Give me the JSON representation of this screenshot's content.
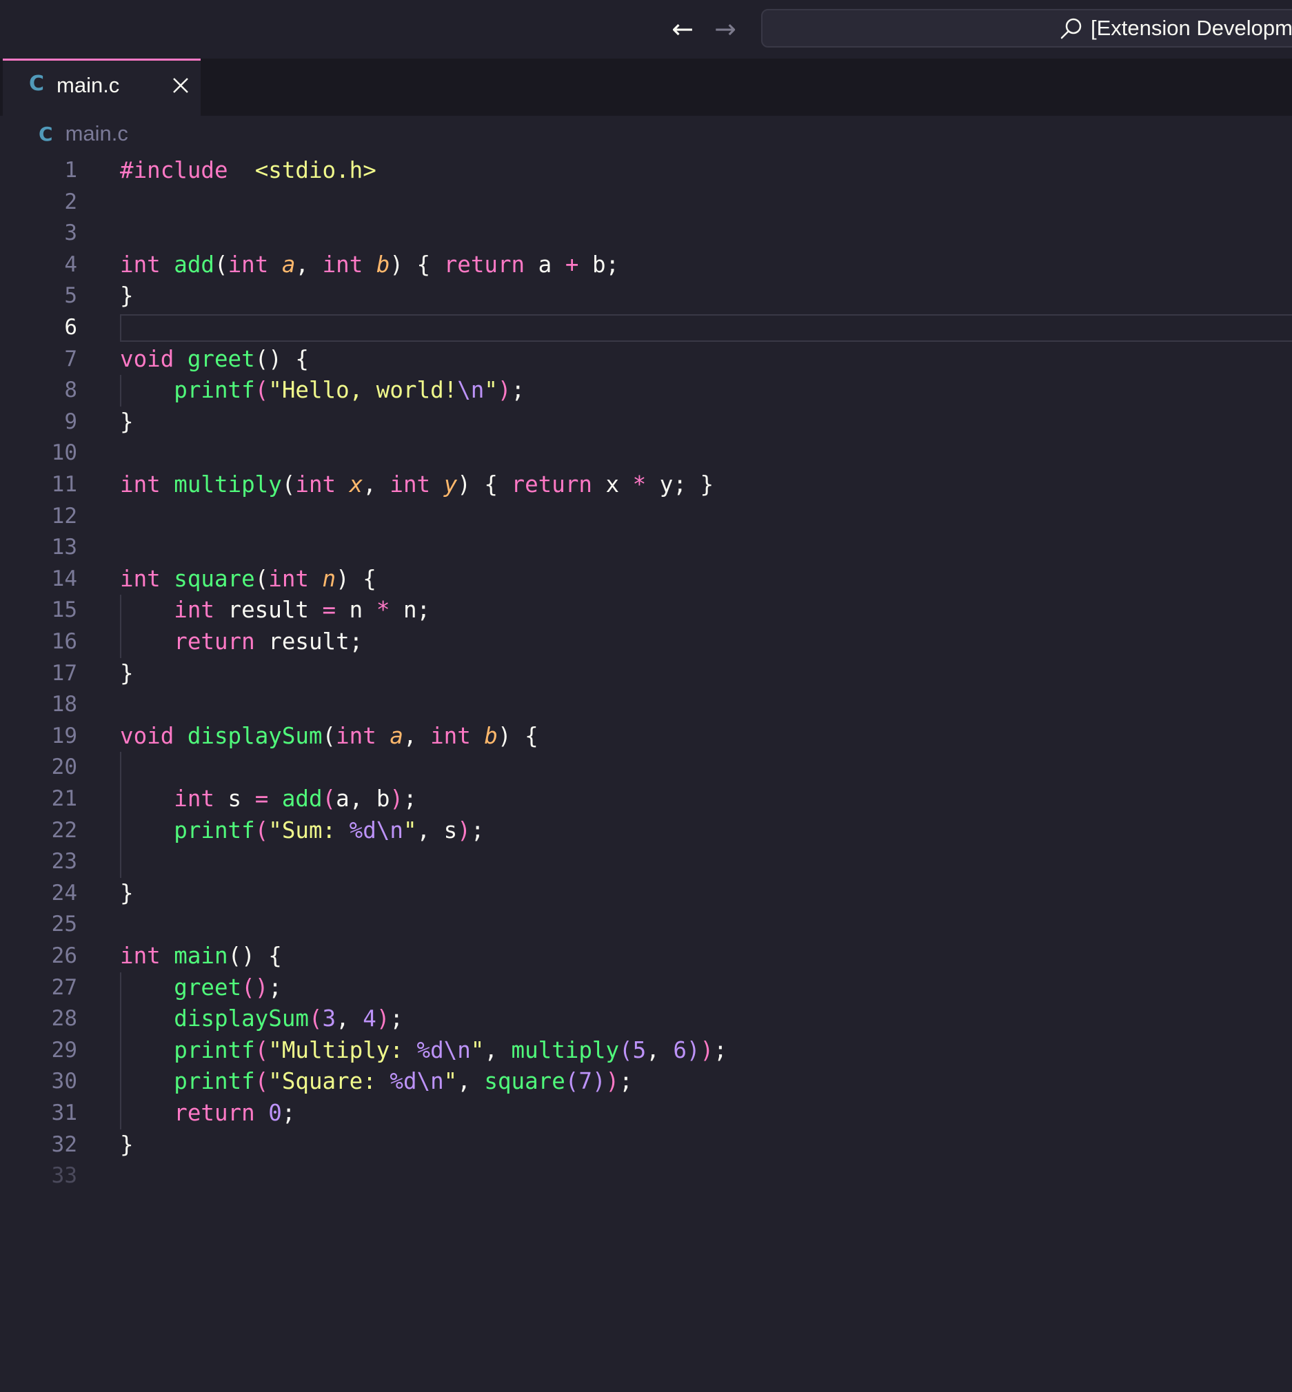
{
  "titlebar": {
    "back_arrow": "←",
    "forward_arrow": "→",
    "command_center_text": "[Extension Development Host]"
  },
  "tab": {
    "language_icon": "C",
    "label": "main.c",
    "close_glyph": "×"
  },
  "breadcrumb": {
    "language_icon": "C",
    "file": "main.c"
  },
  "editor": {
    "active_line": 6,
    "lines": [
      {
        "n": "1",
        "tokens": [
          [
            "kw",
            "#include"
          ],
          [
            "",
            "  "
          ],
          [
            "st",
            "<stdio.h>"
          ]
        ]
      },
      {
        "n": "2",
        "tokens": []
      },
      {
        "n": "3",
        "tokens": []
      },
      {
        "n": "4",
        "tokens": [
          [
            "kw",
            "int"
          ],
          [
            "",
            " "
          ],
          [
            "fn",
            "add"
          ],
          [
            "",
            "("
          ],
          [
            "kw",
            "int"
          ],
          [
            "",
            " "
          ],
          [
            "pm",
            "a"
          ],
          [
            "",
            ", "
          ],
          [
            "kw",
            "int"
          ],
          [
            "",
            " "
          ],
          [
            "pm",
            "b"
          ],
          [
            "",
            ") { "
          ],
          [
            "kw",
            "return"
          ],
          [
            "",
            " a "
          ],
          [
            "kw",
            "+"
          ],
          [
            "",
            " b;"
          ]
        ]
      },
      {
        "n": "5",
        "tokens": [
          [
            "",
            "}"
          ]
        ]
      },
      {
        "n": "6",
        "tokens": []
      },
      {
        "n": "7",
        "tokens": [
          [
            "kw",
            "void"
          ],
          [
            "",
            " "
          ],
          [
            "fn",
            "greet"
          ],
          [
            "",
            "() {"
          ]
        ]
      },
      {
        "n": "8",
        "tokens": [
          [
            "",
            "    "
          ],
          [
            "fn",
            "printf"
          ],
          [
            "bp",
            "("
          ],
          [
            "st",
            "\"Hello, world!"
          ],
          [
            "nm",
            "\\n"
          ],
          [
            "st",
            "\""
          ],
          [
            "bp",
            ")"
          ],
          [
            "",
            ";"
          ]
        ]
      },
      {
        "n": "9",
        "tokens": [
          [
            "",
            "}"
          ]
        ]
      },
      {
        "n": "10",
        "tokens": []
      },
      {
        "n": "11",
        "tokens": [
          [
            "kw",
            "int"
          ],
          [
            "",
            " "
          ],
          [
            "fn",
            "multiply"
          ],
          [
            "",
            "("
          ],
          [
            "kw",
            "int"
          ],
          [
            "",
            " "
          ],
          [
            "pm",
            "x"
          ],
          [
            "",
            ", "
          ],
          [
            "kw",
            "int"
          ],
          [
            "",
            " "
          ],
          [
            "pm",
            "y"
          ],
          [
            "",
            ") { "
          ],
          [
            "kw",
            "return"
          ],
          [
            "",
            " x "
          ],
          [
            "kw",
            "*"
          ],
          [
            "",
            " y; }"
          ]
        ]
      },
      {
        "n": "12",
        "tokens": []
      },
      {
        "n": "13",
        "tokens": []
      },
      {
        "n": "14",
        "tokens": [
          [
            "kw",
            "int"
          ],
          [
            "",
            " "
          ],
          [
            "fn",
            "square"
          ],
          [
            "",
            "("
          ],
          [
            "kw",
            "int"
          ],
          [
            "",
            " "
          ],
          [
            "pm",
            "n"
          ],
          [
            "",
            ") {"
          ]
        ]
      },
      {
        "n": "15",
        "tokens": [
          [
            "",
            "    "
          ],
          [
            "kw",
            "int"
          ],
          [
            "",
            " result "
          ],
          [
            "kw",
            "="
          ],
          [
            "",
            " n "
          ],
          [
            "kw",
            "*"
          ],
          [
            "",
            " n;"
          ]
        ]
      },
      {
        "n": "16",
        "tokens": [
          [
            "",
            "    "
          ],
          [
            "kw",
            "return"
          ],
          [
            "",
            " result;"
          ]
        ]
      },
      {
        "n": "17",
        "tokens": [
          [
            "",
            "}"
          ]
        ]
      },
      {
        "n": "18",
        "tokens": []
      },
      {
        "n": "19",
        "tokens": [
          [
            "kw",
            "void"
          ],
          [
            "",
            " "
          ],
          [
            "fn",
            "displaySum"
          ],
          [
            "",
            "("
          ],
          [
            "kw",
            "int"
          ],
          [
            "",
            " "
          ],
          [
            "pm",
            "a"
          ],
          [
            "",
            ", "
          ],
          [
            "kw",
            "int"
          ],
          [
            "",
            " "
          ],
          [
            "pm",
            "b"
          ],
          [
            "",
            ") {"
          ]
        ]
      },
      {
        "n": "20",
        "tokens": []
      },
      {
        "n": "21",
        "tokens": [
          [
            "",
            "    "
          ],
          [
            "kw",
            "int"
          ],
          [
            "",
            " s "
          ],
          [
            "kw",
            "="
          ],
          [
            "",
            " "
          ],
          [
            "fn",
            "add"
          ],
          [
            "bp",
            "("
          ],
          [
            "",
            "a, b"
          ],
          [
            "bp",
            ")"
          ],
          [
            "",
            ";"
          ]
        ]
      },
      {
        "n": "22",
        "tokens": [
          [
            "",
            "    "
          ],
          [
            "fn",
            "printf"
          ],
          [
            "bp",
            "("
          ],
          [
            "st",
            "\"Sum: "
          ],
          [
            "nm",
            "%d\\n"
          ],
          [
            "st",
            "\""
          ],
          [
            "",
            ", s"
          ],
          [
            "bp",
            ")"
          ],
          [
            "",
            ";"
          ]
        ]
      },
      {
        "n": "23",
        "tokens": []
      },
      {
        "n": "24",
        "tokens": [
          [
            "",
            "}"
          ]
        ]
      },
      {
        "n": "25",
        "tokens": []
      },
      {
        "n": "26",
        "tokens": [
          [
            "kw",
            "int"
          ],
          [
            "",
            " "
          ],
          [
            "fn",
            "main"
          ],
          [
            "",
            "() {"
          ]
        ]
      },
      {
        "n": "27",
        "tokens": [
          [
            "",
            "    "
          ],
          [
            "fn",
            "greet"
          ],
          [
            "bp",
            "()"
          ],
          [
            "",
            ";"
          ]
        ]
      },
      {
        "n": "28",
        "tokens": [
          [
            "",
            "    "
          ],
          [
            "fn",
            "displaySum"
          ],
          [
            "bp",
            "("
          ],
          [
            "nm",
            "3"
          ],
          [
            "",
            ", "
          ],
          [
            "nm",
            "4"
          ],
          [
            "bp",
            ")"
          ],
          [
            "",
            ";"
          ]
        ]
      },
      {
        "n": "29",
        "tokens": [
          [
            "",
            "    "
          ],
          [
            "fn",
            "printf"
          ],
          [
            "bp",
            "("
          ],
          [
            "st",
            "\"Multiply: "
          ],
          [
            "nm",
            "%d\\n"
          ],
          [
            "st",
            "\""
          ],
          [
            "",
            ", "
          ],
          [
            "fn",
            "multiply"
          ],
          [
            "nm",
            "("
          ],
          [
            "nm",
            "5"
          ],
          [
            "",
            ", "
          ],
          [
            "nm",
            "6"
          ],
          [
            "nm",
            ")"
          ],
          [
            "bp",
            ")"
          ],
          [
            "",
            ";"
          ]
        ]
      },
      {
        "n": "30",
        "tokens": [
          [
            "",
            "    "
          ],
          [
            "fn",
            "printf"
          ],
          [
            "bp",
            "("
          ],
          [
            "st",
            "\"Square: "
          ],
          [
            "nm",
            "%d\\n"
          ],
          [
            "st",
            "\""
          ],
          [
            "",
            ", "
          ],
          [
            "fn",
            "square"
          ],
          [
            "nm",
            "("
          ],
          [
            "nm",
            "7"
          ],
          [
            "nm",
            ")"
          ],
          [
            "bp",
            ")"
          ],
          [
            "",
            ";"
          ]
        ]
      },
      {
        "n": "31",
        "tokens": [
          [
            "",
            "    "
          ],
          [
            "kw",
            "return"
          ],
          [
            "",
            " "
          ],
          [
            "nm",
            "0"
          ],
          [
            "",
            ";"
          ]
        ]
      },
      {
        "n": "32",
        "tokens": [
          [
            "",
            "}"
          ]
        ]
      },
      {
        "n": "33",
        "tokens": []
      }
    ]
  },
  "colors": {
    "background": "#22212c",
    "keyword": "#ff79c6",
    "function": "#50fa7b",
    "parameter": "#ffb86c",
    "string": "#f1fa8c",
    "number": "#bd93f9",
    "tab_accent": "#ff79c6"
  }
}
